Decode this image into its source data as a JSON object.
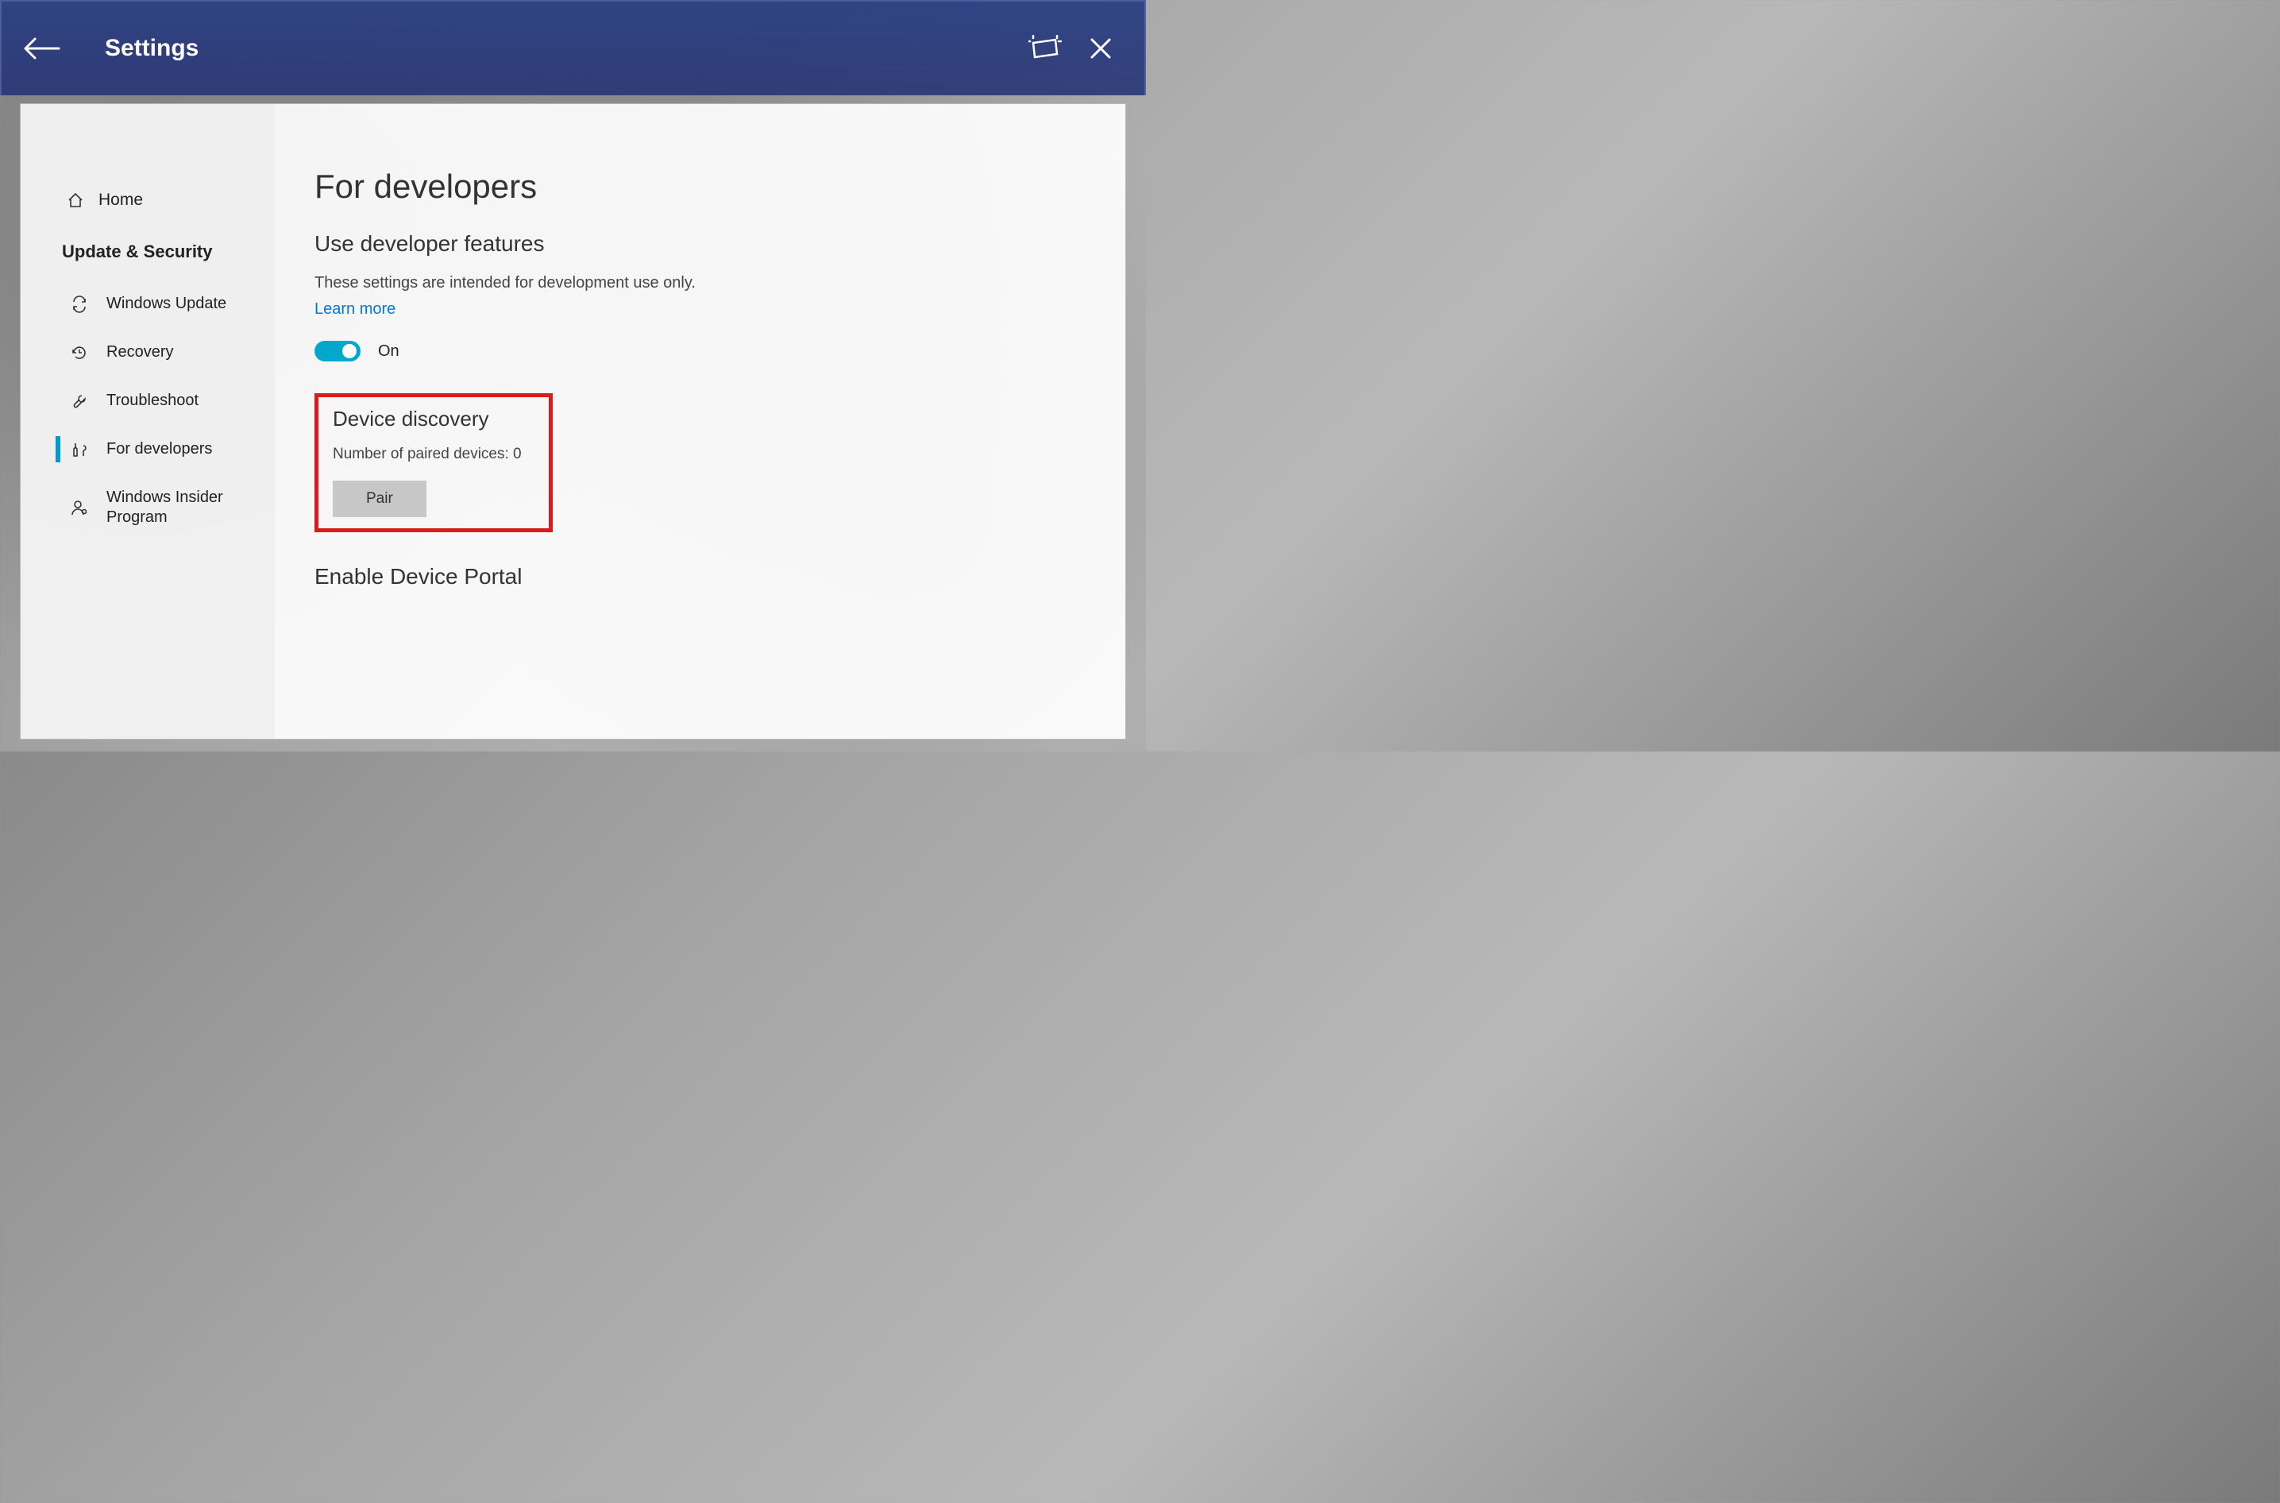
{
  "titlebar": {
    "title": "Settings"
  },
  "sidebar": {
    "home_label": "Home",
    "category_label": "Update & Security",
    "items": [
      {
        "label": "Windows Update"
      },
      {
        "label": "Recovery"
      },
      {
        "label": "Troubleshoot"
      },
      {
        "label": "For developers"
      },
      {
        "label": "Windows Insider Program"
      }
    ]
  },
  "content": {
    "page_title": "For developers",
    "section1_title": "Use developer features",
    "section1_desc": "These settings are intended for development use only.",
    "learn_more": "Learn more",
    "toggle_state": "On",
    "device_discovery_title": "Device discovery",
    "paired_devices_label": "Number of paired devices: 0",
    "pair_button": "Pair",
    "device_portal_title": "Enable Device Portal"
  }
}
